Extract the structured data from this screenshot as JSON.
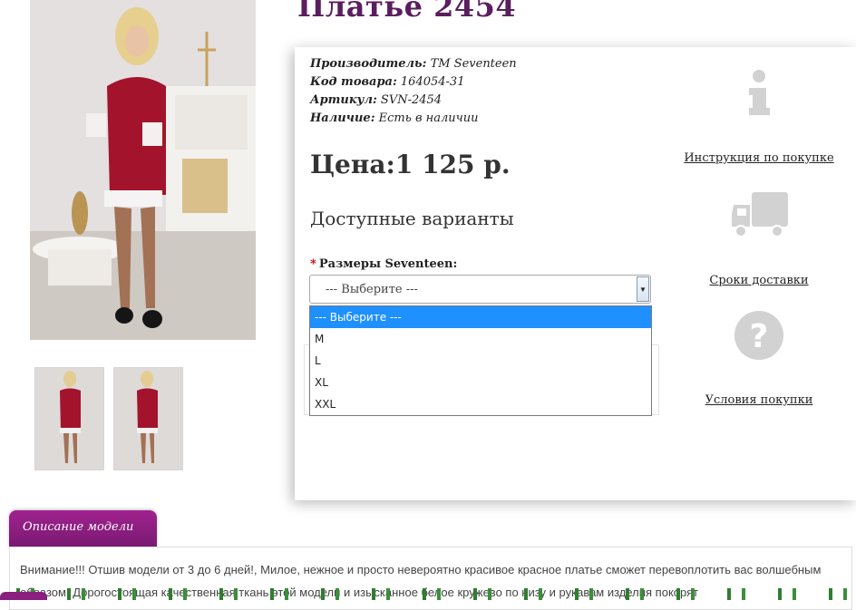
{
  "product": {
    "title": "Платье 2454",
    "manufacturer_label": "Производитель:",
    "manufacturer_value": "ТМ Seventeen",
    "code_label": "Код товара:",
    "code_value": "164054-31",
    "sku_label": "Артикул:",
    "sku_value": "SVN-2454",
    "stock_label": "Наличие:",
    "stock_value": "Есть в наличии",
    "price": "Цена:1 125 р."
  },
  "variants": {
    "title": "Доступные варианты",
    "required_mark": "*",
    "size_label": "Размеры Seventeen:",
    "selected": "--- Выберите ---",
    "options": [
      "--- Выберите ---",
      "M",
      "L",
      "XL",
      "XXL"
    ]
  },
  "side_links": {
    "instruction": "Инструкция по покупке",
    "delivery": "Сроки доставки",
    "conditions": "Условия покупки"
  },
  "description": {
    "tab_label": "Описание модели",
    "text": "Внимание!!! Отшив модели от 3 до 6 дней!, Милое, нежное и просто невероятно красивое красное платье сможет перевоплотить вас волшебным образом. Дорогостоящая качественная ткань этой модели и изысканное белое кружево по низу и рукавам изделия покорят"
  },
  "colors": {
    "title": "#5a1e5f",
    "tab": "#8a1f80",
    "dress": "#a3142c",
    "highlight": "#1e90ff"
  }
}
